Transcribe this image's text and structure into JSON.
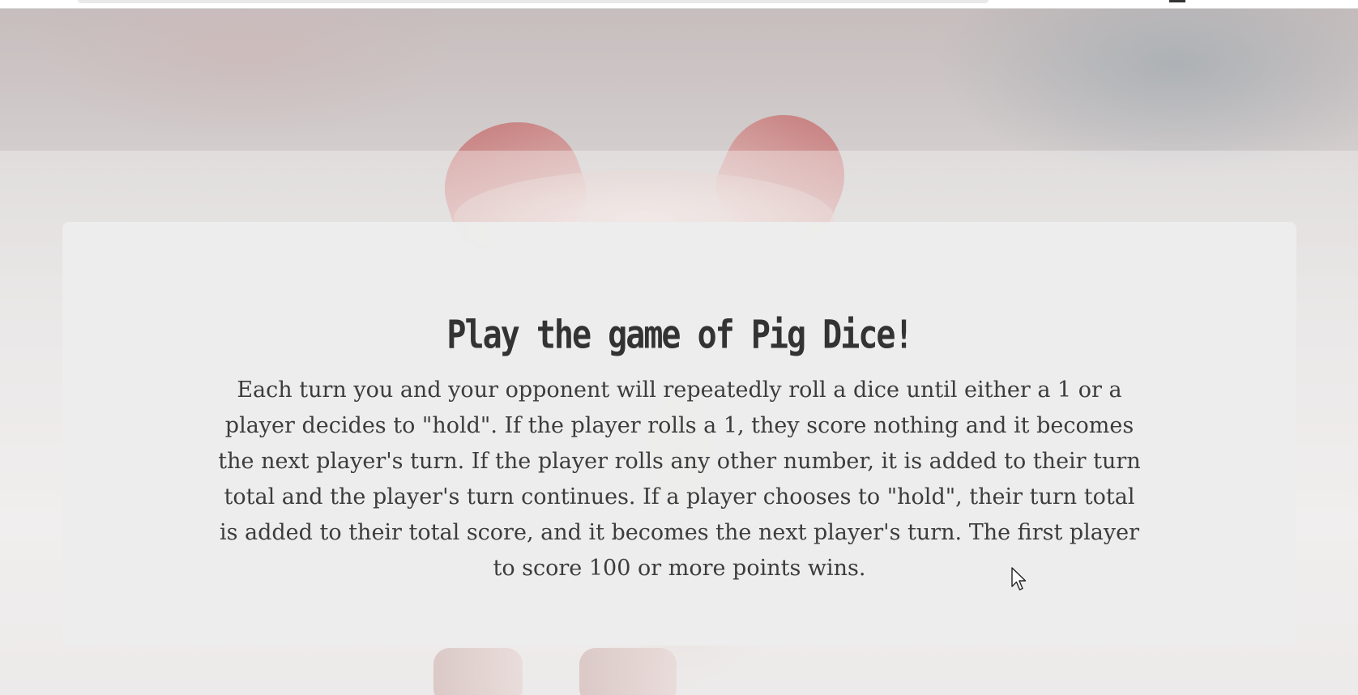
{
  "game_card": {
    "title": "Play the game of Pig Dice!",
    "rules": "Each turn you and your opponent will repeatedly roll a dice until either a 1 or a player decides to \"hold\". If the player rolls a 1, they score nothing and it becomes the next player's turn. If the player rolls any other number, it is added to their turn total and the player's turn continues. If a player chooses to \"hold\", their turn total is added to their total score, and it becomes the next player's turn. The first player to score 100 or more points wins."
  },
  "background": {
    "image_subject": "pig"
  },
  "icons": {
    "cursor": "mouse-pointer-icon"
  },
  "colors": {
    "card_background": "#ededed",
    "text": "#333333"
  }
}
